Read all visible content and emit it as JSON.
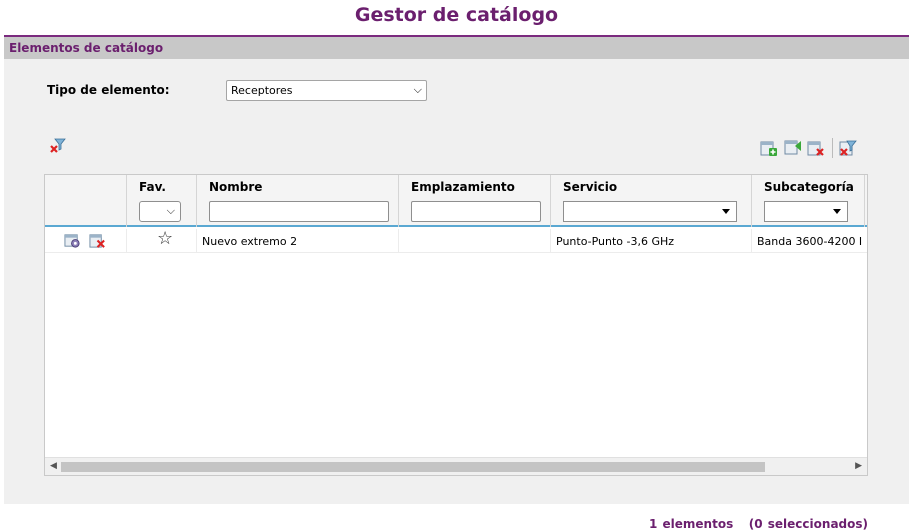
{
  "header": {
    "title": "Gestor de catálogo"
  },
  "panel": {
    "title": "Elementos de catálogo"
  },
  "filter": {
    "type_label": "Tipo de elemento:",
    "type_value": "Receptores"
  },
  "toolbar": {
    "clear_filters_icon": "funnel-clear-icon",
    "right_icons": [
      "add-item-icon",
      "import-item-icon",
      "delete-items-icon",
      "clear-filter-icon"
    ]
  },
  "table": {
    "columns": [
      "",
      "Fav.",
      "Nombre",
      "Emplazamiento",
      "Servicio",
      "Subcategoría"
    ],
    "rows": [
      {
        "actions": [
          "edit-icon",
          "delete-icon"
        ],
        "fav": "☆",
        "nombre": "Nuevo extremo 2",
        "emplazamiento": "",
        "servicio": "Punto-Punto -3,6 GHz",
        "subcategoria": "Banda 3600-4200 I"
      }
    ]
  },
  "footer": {
    "count_text": "1 elementos",
    "selected_text": "(0 seleccionados)"
  },
  "colors": {
    "brand": "#6b1f6e",
    "header_bar": "#c8c8c8",
    "accent_line": "#5aa8d2"
  }
}
